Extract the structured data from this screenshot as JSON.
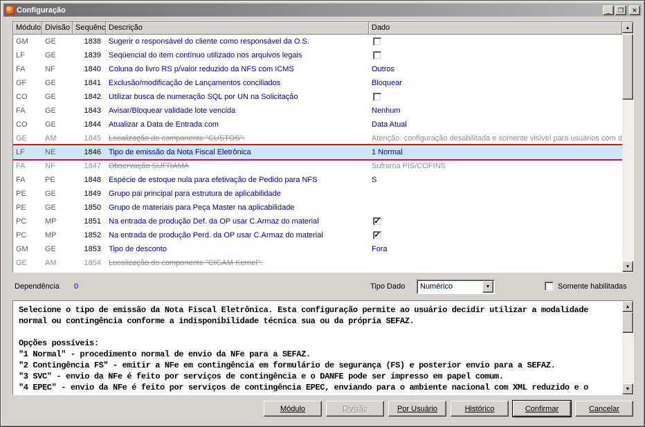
{
  "window": {
    "title": "Configuração",
    "controls": {
      "minimize": "_",
      "maximize": "❐",
      "close": "✕"
    }
  },
  "icons": {
    "scroll_up": "▲",
    "scroll_down": "▼",
    "combo_arrow": "▼",
    "check": "✓"
  },
  "colors": {
    "navy": "#000099",
    "link_blue": "#0000cc",
    "selected_bg": "#cde6f7",
    "selected_border": "#dd1111",
    "disabled_gray": "#8c8c8c",
    "titlebar_start": "#6d6d6d",
    "titlebar_end": "#b5b5b5"
  },
  "table": {
    "columns": [
      "Módulo",
      "Divisão",
      "Sequência",
      "Descrição",
      "Dado"
    ],
    "rows": [
      {
        "modulo": "GM",
        "divisao": "GE",
        "sequencia": "1838",
        "descricao": "Sugerir o responsável do cliente como responsável da O.S.",
        "dado": "",
        "dado_kind": "checkbox",
        "checked": false,
        "state": "normal"
      },
      {
        "modulo": "LF",
        "divisao": "GE",
        "sequencia": "1839",
        "descricao": "Seqüencial do item contínuo utilizado nos arquivos legais",
        "dado": "",
        "dado_kind": "checkbox",
        "checked": false,
        "state": "normal"
      },
      {
        "modulo": "FA",
        "divisao": "NF",
        "sequencia": "1840",
        "descricao": "Coluna do livro RS p/valor reduzido da NFS com ICMS",
        "dado": "Outros",
        "dado_kind": "text",
        "checked": false,
        "state": "normal"
      },
      {
        "modulo": "GF",
        "divisao": "GE",
        "sequencia": "1841",
        "descricao": "Exclusão/modificação de Lançamentos conciliados",
        "dado": "Bloquear",
        "dado_kind": "text",
        "checked": false,
        "state": "normal"
      },
      {
        "modulo": "CO",
        "divisao": "GE",
        "sequencia": "1842",
        "descricao": "Utilizar busca de numeração SQL por UN na Solicitação",
        "dado": "",
        "dado_kind": "checkbox",
        "checked": false,
        "state": "normal"
      },
      {
        "modulo": "FA",
        "divisao": "GE",
        "sequencia": "1843",
        "descricao": "Avisar/Bloquear validade lote vencida",
        "dado": "Nenhum",
        "dado_kind": "text",
        "checked": false,
        "state": "normal"
      },
      {
        "modulo": "CO",
        "divisao": "GE",
        "sequencia": "1844",
        "descricao": "Atualizar a Data de Entrada com",
        "dado": "Data Atual",
        "dado_kind": "text",
        "checked": false,
        "state": "normal"
      },
      {
        "modulo": "GE",
        "divisao": "AM",
        "sequencia": "1845",
        "descricao": "Localização do componente \"CUSTOS\":",
        "dado": "Atenção: configuração desabilitada e somente visível para usuários com dir",
        "dado_kind": "text",
        "checked": false,
        "state": "disabled"
      },
      {
        "modulo": "LF",
        "divisao": "NE",
        "sequencia": "1846",
        "descricao": "Tipo de emissão da Nota Fiscal Eletrônica",
        "dado": "1 Normal",
        "dado_kind": "text",
        "checked": false,
        "state": "selected"
      },
      {
        "modulo": "FA",
        "divisao": "NF",
        "sequencia": "1847",
        "descricao": "Observação SUFRAMA",
        "dado": "Suframa PIS/COFINS",
        "dado_kind": "text",
        "checked": false,
        "state": "disabled"
      },
      {
        "modulo": "FA",
        "divisao": "PE",
        "sequencia": "1848",
        "descricao": "Espécie de estoque nula para efetivação de Pedido para NFS",
        "dado": "S",
        "dado_kind": "text",
        "checked": false,
        "state": "normal"
      },
      {
        "modulo": "PE",
        "divisao": "GE",
        "sequencia": "1849",
        "descricao": "Grupo pai principal para estrutura de aplicabilidade",
        "dado": "",
        "dado_kind": "text",
        "checked": false,
        "state": "normal"
      },
      {
        "modulo": "PE",
        "divisao": "GE",
        "sequencia": "1850",
        "descricao": "Grupo de materiais para Peça Master na aplicabilidade",
        "dado": "",
        "dado_kind": "text",
        "checked": false,
        "state": "normal"
      },
      {
        "modulo": "PC",
        "divisao": "MP",
        "sequencia": "1851",
        "descricao": "Na entrada de produção Def. da OP usar C.Armaz do material",
        "dado": "",
        "dado_kind": "checkbox",
        "checked": true,
        "state": "normal"
      },
      {
        "modulo": "PC",
        "divisao": "MP",
        "sequencia": "1852",
        "descricao": "Na entrada de produção Perd. da OP usar C.Armaz do material",
        "dado": "",
        "dado_kind": "checkbox",
        "checked": true,
        "state": "normal"
      },
      {
        "modulo": "GM",
        "divisao": "GE",
        "sequencia": "1853",
        "descricao": "Tipo de desconto",
        "dado": "Fora",
        "dado_kind": "text",
        "checked": false,
        "state": "normal"
      },
      {
        "modulo": "GE",
        "divisao": "AM",
        "sequencia": "1854",
        "descricao": "Localização do componente \"CIGAM Kernel\":",
        "dado": "",
        "dado_kind": "text",
        "checked": false,
        "state": "disabled"
      }
    ]
  },
  "footer": {
    "dependencia_label": "Dependência",
    "dependencia_value": "0",
    "tipo_dado_label": "Tipo Dado",
    "tipo_dado_value": "Numérico",
    "somente_habilitadas_label": "Somente habilitadas"
  },
  "description": {
    "text": "Selecione o tipo de emissão da Nota Fiscal Eletrônica. Esta configuração permite ao usuário decidir utilizar a modalidade\nnormal ou contingência conforme a indisponibilidade técnica sua ou da própria SEFAZ.\n\nOpções possíveis:\n\"1 Normal\" - procedimento normal de envio da NFe para a SEFAZ.\n\"2 Contingência FS\" - emitir a NFe em contingência em formulário de segurança (FS) e posterior envio para a SEFAZ.\n\"3 SVC\" - envio da NFe é feito por serviços de contingência e o DANFE pode ser impresso em papel comum.\n\"4 EPEC\" - envio da NFe é feito por serviços de contingência EPEC, enviando para o ambiente nacional com XML reduzido e o"
  },
  "buttons": {
    "modulo": "Módulo",
    "divisao": "Divisão",
    "por_usuario": "Por Usuário",
    "historico": "Histórico",
    "confirmar": "Confirmar",
    "cancelar": "Cancelar"
  }
}
